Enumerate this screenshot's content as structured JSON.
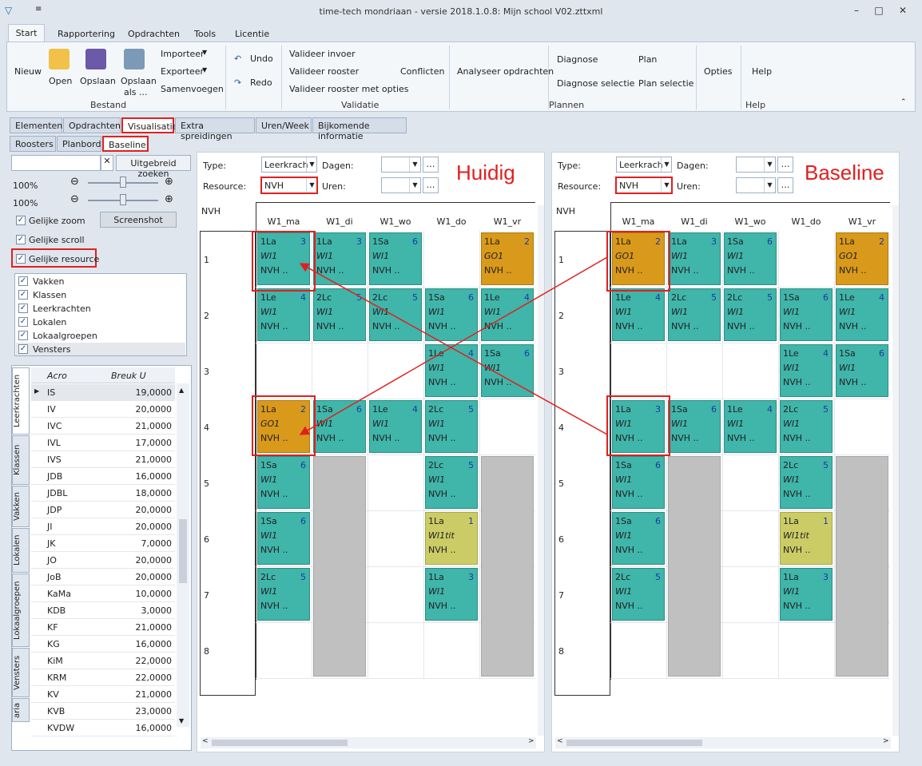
{
  "window": {
    "title": "time-tech mondriaan - versie 2018.1.0.8: Mijn school V02.zttxml"
  },
  "ribbon_tabs": [
    "Start",
    "Rapportering",
    "Opdrachten",
    "Tools",
    "Licentie"
  ],
  "ribbon": {
    "nieuw": "Nieuw",
    "open": "Open",
    "opslaan": "Opslaan",
    "opslaan_als": "Opslaan",
    "opslaan_als2": "als ...",
    "importeer": "Importeer",
    "exporteer": "Exporteer",
    "samenvoegen": "Samenvoegen",
    "undo": "Undo",
    "redo": "Redo",
    "valideer_invoer": "Valideer invoer",
    "valideer_rooster": "Valideer rooster",
    "valideer_opties": "Valideer rooster met opties",
    "conflicten": "Conflicten",
    "analyseer": "Analyseer opdrachten",
    "diagnose": "Diagnose",
    "diagnose_selectie": "Diagnose selectie",
    "plan": "Plan",
    "plan_selectie": "Plan selectie",
    "opties": "Opties",
    "help": "Help",
    "grp_bestand": "Bestand",
    "grp_validatie": "Validatie",
    "grp_plannen": "Plannen",
    "grp_help": "Help"
  },
  "page_tabs": [
    "Elementen",
    "Opdrachten",
    "Visualisatie",
    "Extra spreidingen",
    "Uren/Week",
    "Bijkomende informatie"
  ],
  "sub_tabs": [
    "Roosters",
    "Planbord",
    "Baseline"
  ],
  "left": {
    "search_button": "Uitgebreid zoeken",
    "zoom1": "100%",
    "zoom2": "100%",
    "screenshot": "Screenshot",
    "gelijke_zoom": "Gelijke zoom",
    "gelijke_scroll": "Gelijke scroll",
    "gelijke_resource": "Gelijke resource",
    "list": [
      "Vakken",
      "Klassen",
      "Leerkrachten",
      "Lokalen",
      "Lokaalgroepen",
      "Vensters"
    ]
  },
  "vertical_tabs": [
    "Leerkrachten",
    "Klassen",
    "Vakken",
    "Lokalen",
    "Lokaalgroepen",
    "Vensters",
    "aria"
  ],
  "grid": {
    "col1": "Acro",
    "col2": "Breuk U",
    "rows": [
      [
        "IS",
        "19,0000"
      ],
      [
        "IV",
        "20,0000"
      ],
      [
        "IVC",
        "21,0000"
      ],
      [
        "IVL",
        "17,0000"
      ],
      [
        "IVS",
        "21,0000"
      ],
      [
        "JDB",
        "16,0000"
      ],
      [
        "JDBL",
        "18,0000"
      ],
      [
        "JDP",
        "20,0000"
      ],
      [
        "JI",
        "20,0000"
      ],
      [
        "JK",
        "7,0000"
      ],
      [
        "JO",
        "20,0000"
      ],
      [
        "JoB",
        "20,0000"
      ],
      [
        "KaMa",
        "10,0000"
      ],
      [
        "KDB",
        "3,0000"
      ],
      [
        "KF",
        "21,0000"
      ],
      [
        "KG",
        "16,0000"
      ],
      [
        "KiM",
        "22,0000"
      ],
      [
        "KRM",
        "22,0000"
      ],
      [
        "KV",
        "21,0000"
      ],
      [
        "KVB",
        "23,0000"
      ],
      [
        "KVDW",
        "16,0000"
      ]
    ]
  },
  "filters": {
    "type_label": "Type:",
    "type_value": "Leerkrach",
    "dagen_label": "Dagen:",
    "resource_label": "Resource:",
    "resource_value": "NVH",
    "uren_label": "Uren:"
  },
  "titles": {
    "left": "Huidig",
    "right": "Baseline"
  },
  "timetable": {
    "resource": "NVH",
    "days": [
      "W1_ma",
      "W1_di",
      "W1_wo",
      "W1_do",
      "W1_vr"
    ],
    "hours": [
      "1",
      "2",
      "3",
      "4",
      "5",
      "6",
      "7",
      "8"
    ]
  },
  "cells_left": [
    {
      "d": 0,
      "h": 0,
      "a": "1La",
      "n": "3",
      "b": "WI1",
      "c": "NVH ..",
      "k": "t"
    },
    {
      "d": 1,
      "h": 0,
      "a": "1La",
      "n": "3",
      "b": "WI1",
      "c": "NVH ..",
      "k": "t"
    },
    {
      "d": 2,
      "h": 0,
      "a": "1Sa",
      "n": "6",
      "b": "WI1",
      "c": "NVH ..",
      "k": "t"
    },
    {
      "d": 4,
      "h": 0,
      "a": "1La",
      "n": "2",
      "b": "GO1",
      "c": "NVH ..",
      "k": "o"
    },
    {
      "d": 0,
      "h": 1,
      "a": "1Le",
      "n": "4",
      "b": "WI1",
      "c": "NVH ..",
      "k": "t"
    },
    {
      "d": 1,
      "h": 1,
      "a": "2Lc",
      "n": "5",
      "b": "WI1",
      "c": "NVH ..",
      "k": "t"
    },
    {
      "d": 2,
      "h": 1,
      "a": "2Lc",
      "n": "5",
      "b": "WI1",
      "c": "NVH ..",
      "k": "t"
    },
    {
      "d": 3,
      "h": 1,
      "a": "1Sa",
      "n": "6",
      "b": "WI1",
      "c": "NVH ..",
      "k": "t"
    },
    {
      "d": 4,
      "h": 1,
      "a": "1Le",
      "n": "4",
      "b": "WI1",
      "c": "NVH ..",
      "k": "t"
    },
    {
      "d": 3,
      "h": 2,
      "a": "1Le",
      "n": "4",
      "b": "WI1",
      "c": "NVH ..",
      "k": "t"
    },
    {
      "d": 4,
      "h": 2,
      "a": "1Sa",
      "n": "6",
      "b": "WI1",
      "c": "NVH ..",
      "k": "t"
    },
    {
      "d": 0,
      "h": 3,
      "a": "1La",
      "n": "2",
      "b": "GO1",
      "c": "NVH ..",
      "k": "o"
    },
    {
      "d": 1,
      "h": 3,
      "a": "1Sa",
      "n": "6",
      "b": "WI1",
      "c": "NVH ..",
      "k": "t"
    },
    {
      "d": 2,
      "h": 3,
      "a": "1Le",
      "n": "4",
      "b": "WI1",
      "c": "NVH ..",
      "k": "t"
    },
    {
      "d": 3,
      "h": 3,
      "a": "2Lc",
      "n": "5",
      "b": "WI1",
      "c": "NVH ..",
      "k": "t"
    },
    {
      "d": 0,
      "h": 4,
      "a": "1Sa",
      "n": "6",
      "b": "WI1",
      "c": "NVH ..",
      "k": "t"
    },
    {
      "d": 3,
      "h": 4,
      "a": "2Lc",
      "n": "5",
      "b": "WI1",
      "c": "NVH ..",
      "k": "t"
    },
    {
      "d": 0,
      "h": 5,
      "a": "1Sa",
      "n": "6",
      "b": "WI1",
      "c": "NVH ..",
      "k": "t"
    },
    {
      "d": 3,
      "h": 5,
      "a": "1La",
      "n": "1",
      "b": "WI1tit",
      "c": "NVH ..",
      "k": "y"
    },
    {
      "d": 0,
      "h": 6,
      "a": "2Lc",
      "n": "5",
      "b": "WI1",
      "c": "NVH ..",
      "k": "t"
    },
    {
      "d": 3,
      "h": 6,
      "a": "1La",
      "n": "3",
      "b": "WI1",
      "c": "NVH ..",
      "k": "t"
    }
  ],
  "cells_right": [
    {
      "d": 0,
      "h": 0,
      "a": "1La",
      "n": "2",
      "b": "GO1",
      "c": "NVH ..",
      "k": "o"
    },
    {
      "d": 1,
      "h": 0,
      "a": "1La",
      "n": "3",
      "b": "WI1",
      "c": "NVH ..",
      "k": "t"
    },
    {
      "d": 2,
      "h": 0,
      "a": "1Sa",
      "n": "6",
      "b": "WI1",
      "c": "NVH ..",
      "k": "t"
    },
    {
      "d": 4,
      "h": 0,
      "a": "1La",
      "n": "2",
      "b": "GO1",
      "c": "NVH ..",
      "k": "o"
    },
    {
      "d": 0,
      "h": 1,
      "a": "1Le",
      "n": "4",
      "b": "WI1",
      "c": "NVH ..",
      "k": "t"
    },
    {
      "d": 1,
      "h": 1,
      "a": "2Lc",
      "n": "5",
      "b": "WI1",
      "c": "NVH ..",
      "k": "t"
    },
    {
      "d": 2,
      "h": 1,
      "a": "2Lc",
      "n": "5",
      "b": "WI1",
      "c": "NVH ..",
      "k": "t"
    },
    {
      "d": 3,
      "h": 1,
      "a": "1Sa",
      "n": "6",
      "b": "WI1",
      "c": "NVH ..",
      "k": "t"
    },
    {
      "d": 4,
      "h": 1,
      "a": "1Le",
      "n": "4",
      "b": "WI1",
      "c": "NVH ..",
      "k": "t"
    },
    {
      "d": 3,
      "h": 2,
      "a": "1Le",
      "n": "4",
      "b": "WI1",
      "c": "NVH ..",
      "k": "t"
    },
    {
      "d": 4,
      "h": 2,
      "a": "1Sa",
      "n": "6",
      "b": "WI1",
      "c": "NVH ..",
      "k": "t"
    },
    {
      "d": 0,
      "h": 3,
      "a": "1La",
      "n": "3",
      "b": "WI1",
      "c": "NVH ..",
      "k": "t"
    },
    {
      "d": 1,
      "h": 3,
      "a": "1Sa",
      "n": "6",
      "b": "WI1",
      "c": "NVH ..",
      "k": "t"
    },
    {
      "d": 2,
      "h": 3,
      "a": "1Le",
      "n": "4",
      "b": "WI1",
      "c": "NVH ..",
      "k": "t"
    },
    {
      "d": 3,
      "h": 3,
      "a": "2Lc",
      "n": "5",
      "b": "WI1",
      "c": "NVH ..",
      "k": "t"
    },
    {
      "d": 0,
      "h": 4,
      "a": "1Sa",
      "n": "6",
      "b": "WI1",
      "c": "NVH ..",
      "k": "t"
    },
    {
      "d": 3,
      "h": 4,
      "a": "2Lc",
      "n": "5",
      "b": "WI1",
      "c": "NVH ..",
      "k": "t"
    },
    {
      "d": 0,
      "h": 5,
      "a": "1Sa",
      "n": "6",
      "b": "WI1",
      "c": "NVH ..",
      "k": "t"
    },
    {
      "d": 3,
      "h": 5,
      "a": "1La",
      "n": "1",
      "b": "WI1tit",
      "c": "NVH ..",
      "k": "y"
    },
    {
      "d": 0,
      "h": 6,
      "a": "2Lc",
      "n": "5",
      "b": "WI1",
      "c": "NVH ..",
      "k": "t"
    },
    {
      "d": 3,
      "h": 6,
      "a": "1La",
      "n": "3",
      "b": "WI1",
      "c": "NVH ..",
      "k": "t"
    }
  ]
}
